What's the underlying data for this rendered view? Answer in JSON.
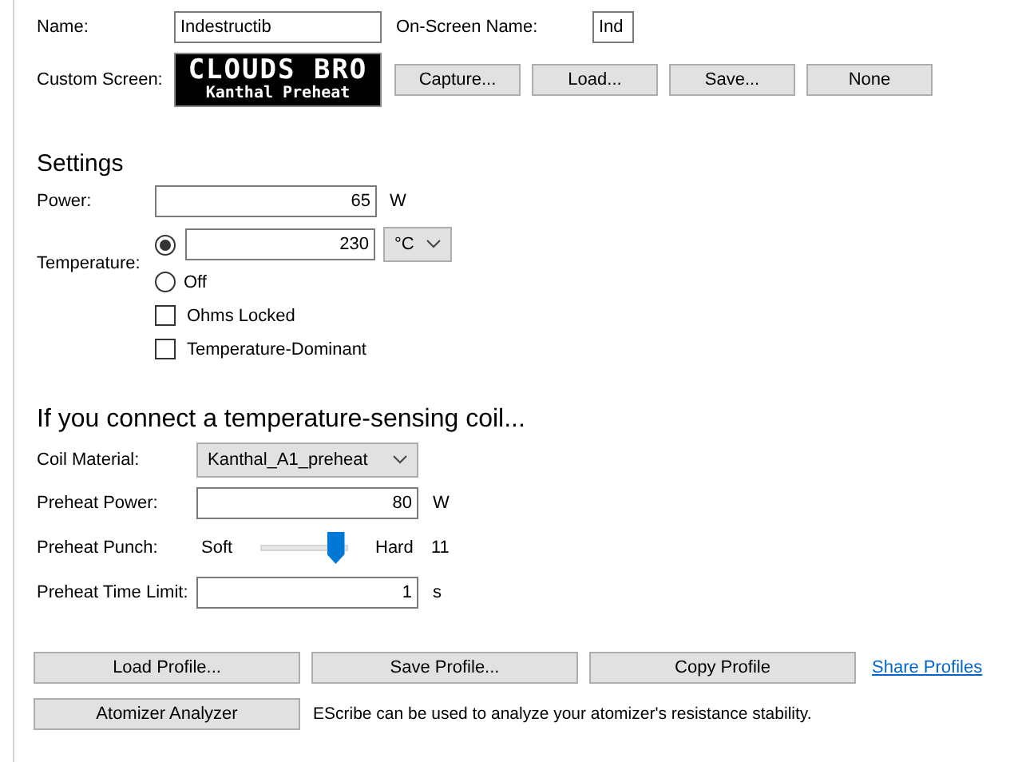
{
  "name": {
    "label": "Name:",
    "value": "Indestructib"
  },
  "onscreen_name": {
    "label": "On-Screen Name:",
    "value": "Ind"
  },
  "custom_screen": {
    "label": "Custom Screen:",
    "line_1": "CLOUDS BRO",
    "line_2": "Kanthal Preheat",
    "buttons": [
      "Capture...",
      "Load...",
      "Save...",
      "None"
    ]
  },
  "settings": {
    "heading": "Settings",
    "power": {
      "label": "Power:",
      "value": "65",
      "unit": "W"
    },
    "temperature": {
      "label": "Temperature:",
      "options": [
        {
          "kind": "value",
          "selected": true,
          "value": "230",
          "unit": "°C"
        },
        {
          "kind": "off",
          "selected": false,
          "label": "Off"
        }
      ]
    },
    "checkboxes": [
      {
        "label": "Ohms Locked",
        "checked": false
      },
      {
        "label": "Temperature-Dominant",
        "checked": false
      }
    ]
  },
  "coil": {
    "heading": "If you connect a temperature-sensing coil...",
    "material": {
      "label": "Coil Material:",
      "value": "Kanthal_A1_preheat"
    },
    "preheat_power": {
      "label": "Preheat Power:",
      "value": "80",
      "unit": "W"
    },
    "preheat_punch": {
      "label": "Preheat Punch:",
      "min_label": "Soft",
      "max_label": "Hard",
      "level": 0.85,
      "reading": "11"
    },
    "preheat_time_limit": {
      "label": "Preheat Time Limit:",
      "value": "1",
      "unit": "s"
    }
  },
  "profile_buttons": [
    "Load Profile...",
    "Save Profile...",
    "Copy Profile"
  ],
  "share_link": "Share Profiles",
  "analyzer_button": "Atomizer Analyzer",
  "analyzer_note": "EScribe can be used to analyze your atomizer's resistance stability."
}
